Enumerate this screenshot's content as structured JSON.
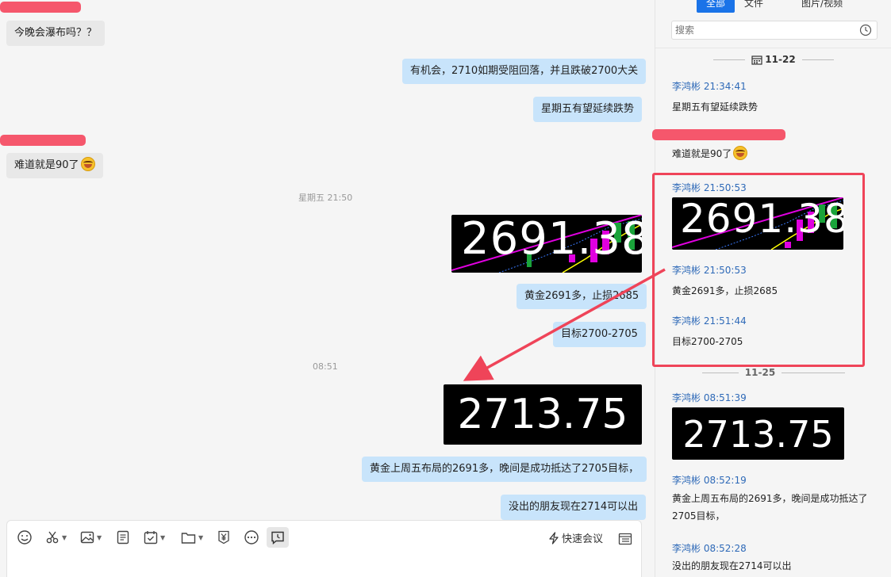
{
  "chat": {
    "messages": {
      "m1": "今晚会瀑布吗？？",
      "m2": "有机会，2710如期受阻回落，并且跌破2700大关",
      "m3": "星期五有望延续跌势",
      "m4": "难道就是90了",
      "ts1": "星期五 21:50",
      "img1": "2691.38",
      "m5": "黄金2691多，止损2685",
      "m6": "目标2700-2705",
      "ts2": "08:51",
      "img2": "2713.75",
      "m7": "黄金上周五布局的2691多，晚间是成功抵达了2705目标，",
      "m8": "没出的朋友现在2714可以出"
    },
    "composer": {
      "quick_meeting": "快速会议"
    }
  },
  "panel": {
    "tabs": [
      "全部",
      "文件",
      "图片/视频"
    ],
    "search_placeholder": "搜索",
    "date1": "11-22",
    "date2": "11-25",
    "items": [
      {
        "meta": "李鸿彬 21:34:41",
        "text": "星期五有望延续跌势"
      },
      {
        "meta": "",
        "text": "难道就是90了"
      },
      {
        "meta": "李鸿彬 21:50:53",
        "image": "2691.38"
      },
      {
        "meta": "李鸿彬 21:50:53",
        "text": "黄金2691多，止损2685"
      },
      {
        "meta": "李鸿彬 21:51:44",
        "text": "目标2700-2705"
      },
      {
        "meta": "李鸿彬 08:51:39",
        "image": "2713.75"
      },
      {
        "meta": "李鸿彬 08:52:19",
        "text": "黄金上周五布局的2691多，晚间是成功抵达了2705目标，"
      },
      {
        "meta": "李鸿彬 08:52:28",
        "text": "没出的朋友现在2714可以出"
      }
    ]
  },
  "colors": {
    "accent": "#1a73e8",
    "out_bubble": "#c8e4fb",
    "in_bubble": "#e8e8e8",
    "highlight": "#ef4459",
    "meta_blue": "#2f6ab8"
  }
}
